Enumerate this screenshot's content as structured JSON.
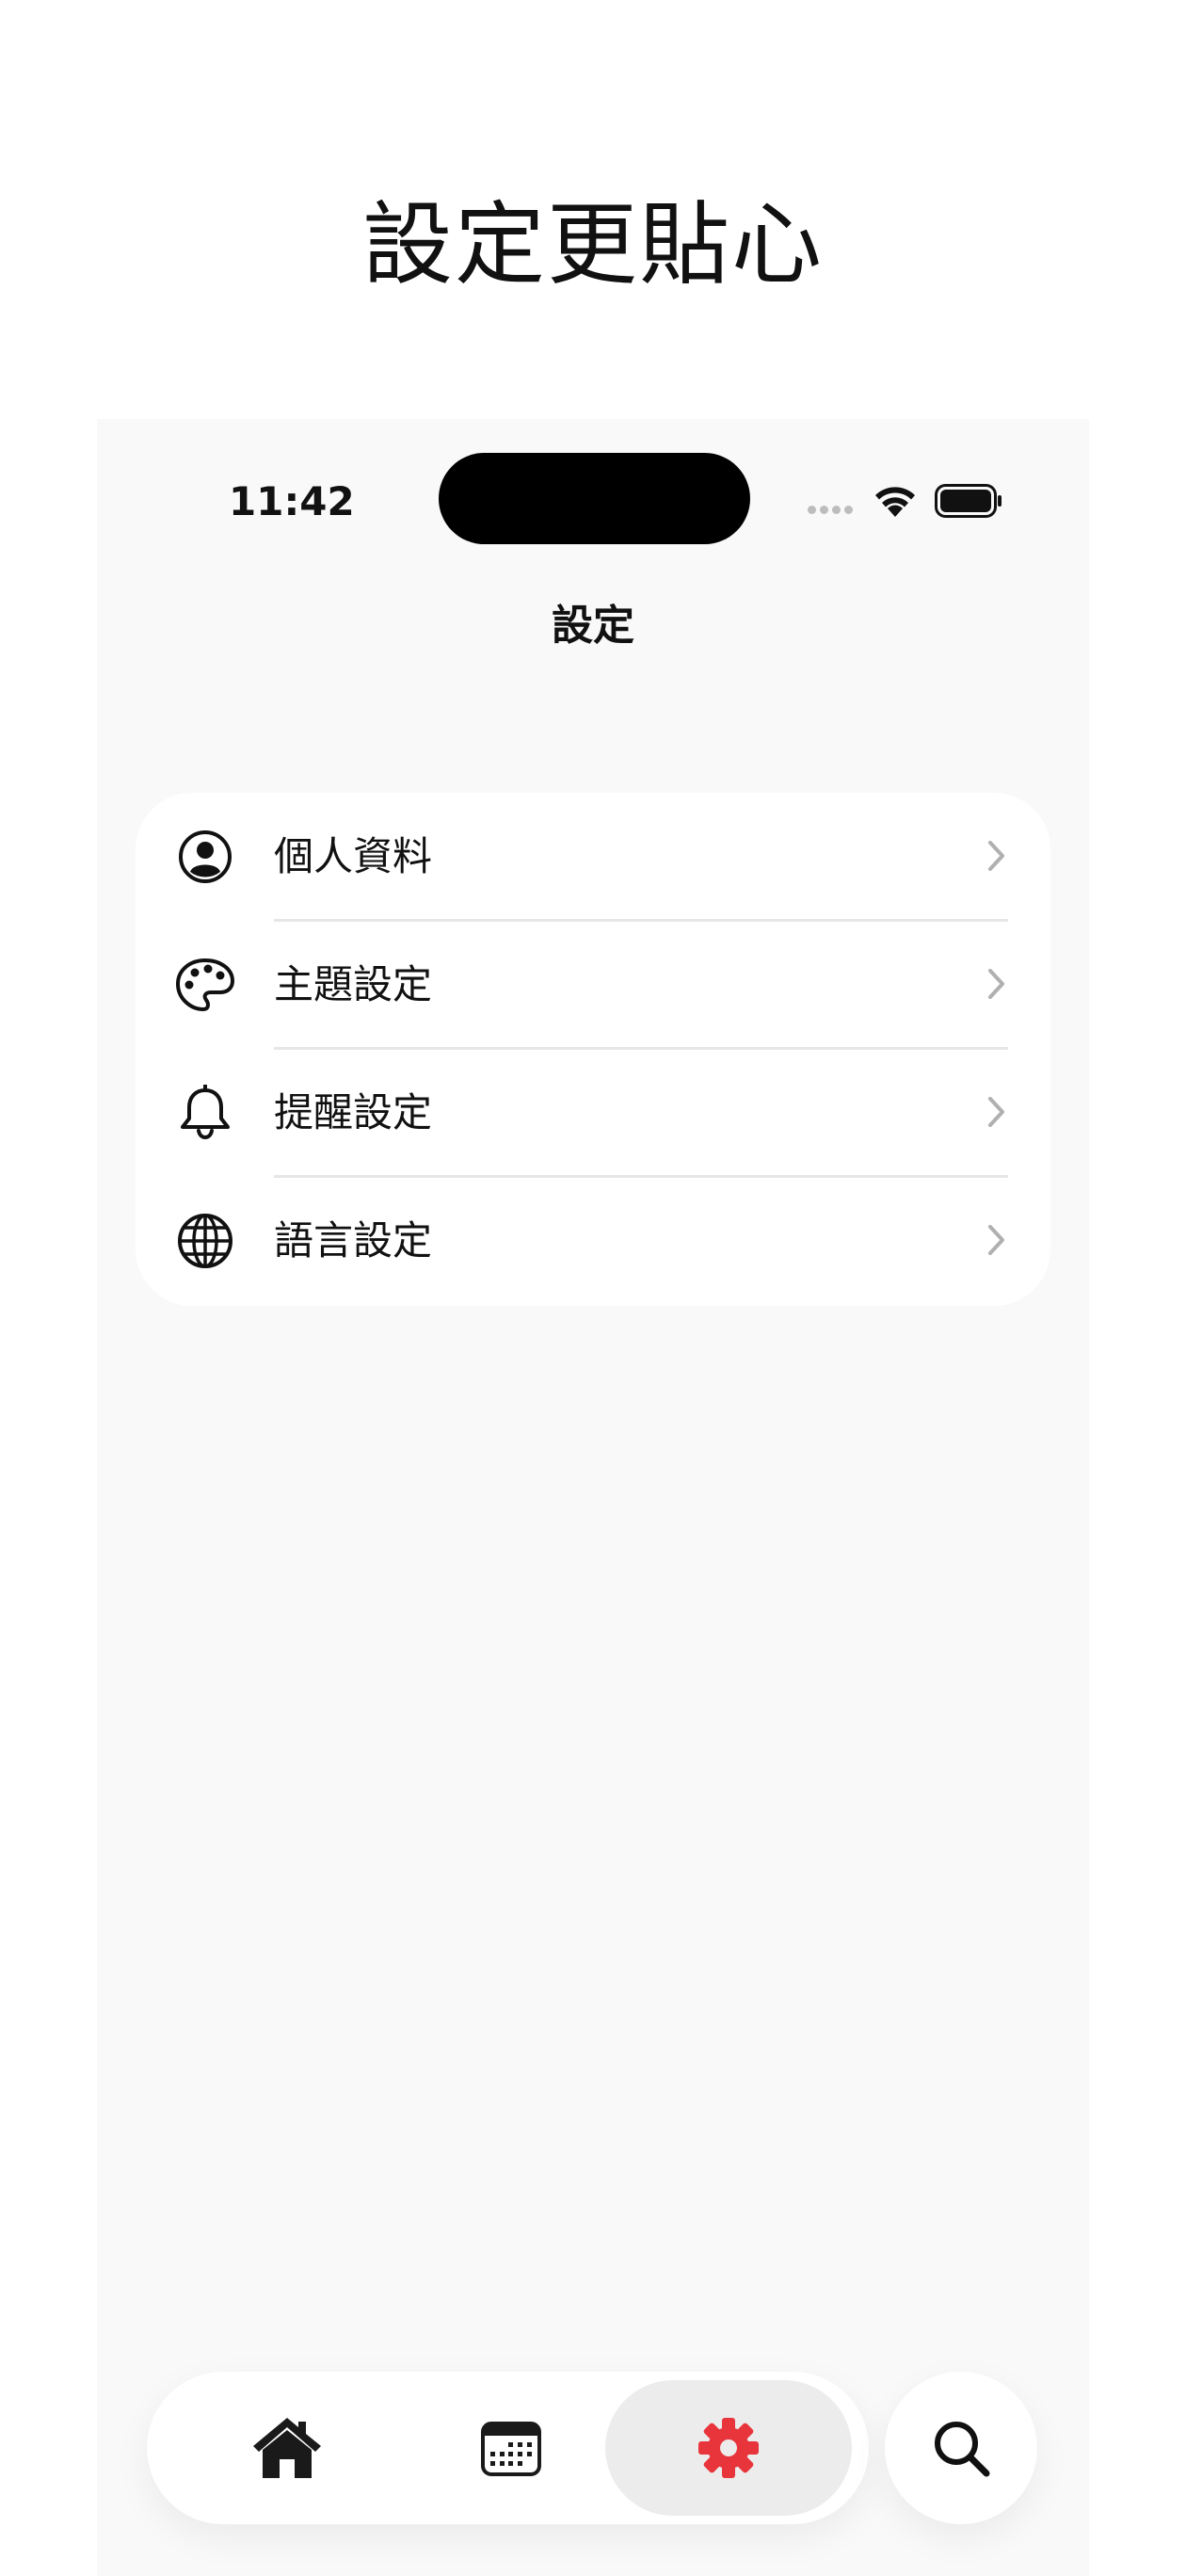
{
  "headline": "設定更貼心",
  "status_bar": {
    "time": "11:42"
  },
  "nav": {
    "title": "設定"
  },
  "settings": {
    "items": [
      {
        "label": "個人資料",
        "icon": "person-circle-icon"
      },
      {
        "label": "主題設定",
        "icon": "palette-icon"
      },
      {
        "label": "提醒設定",
        "icon": "bell-icon"
      },
      {
        "label": "語言設定",
        "icon": "globe-icon"
      }
    ]
  },
  "tab_bar": {
    "tabs": [
      {
        "icon": "home-icon",
        "active": false
      },
      {
        "icon": "calendar-icon",
        "active": false
      },
      {
        "icon": "gear-icon",
        "active": true
      }
    ],
    "search_icon": "search-icon"
  },
  "colors": {
    "accent": "#e8343b",
    "background": "#f9f9f9",
    "card": "#ffffff"
  }
}
